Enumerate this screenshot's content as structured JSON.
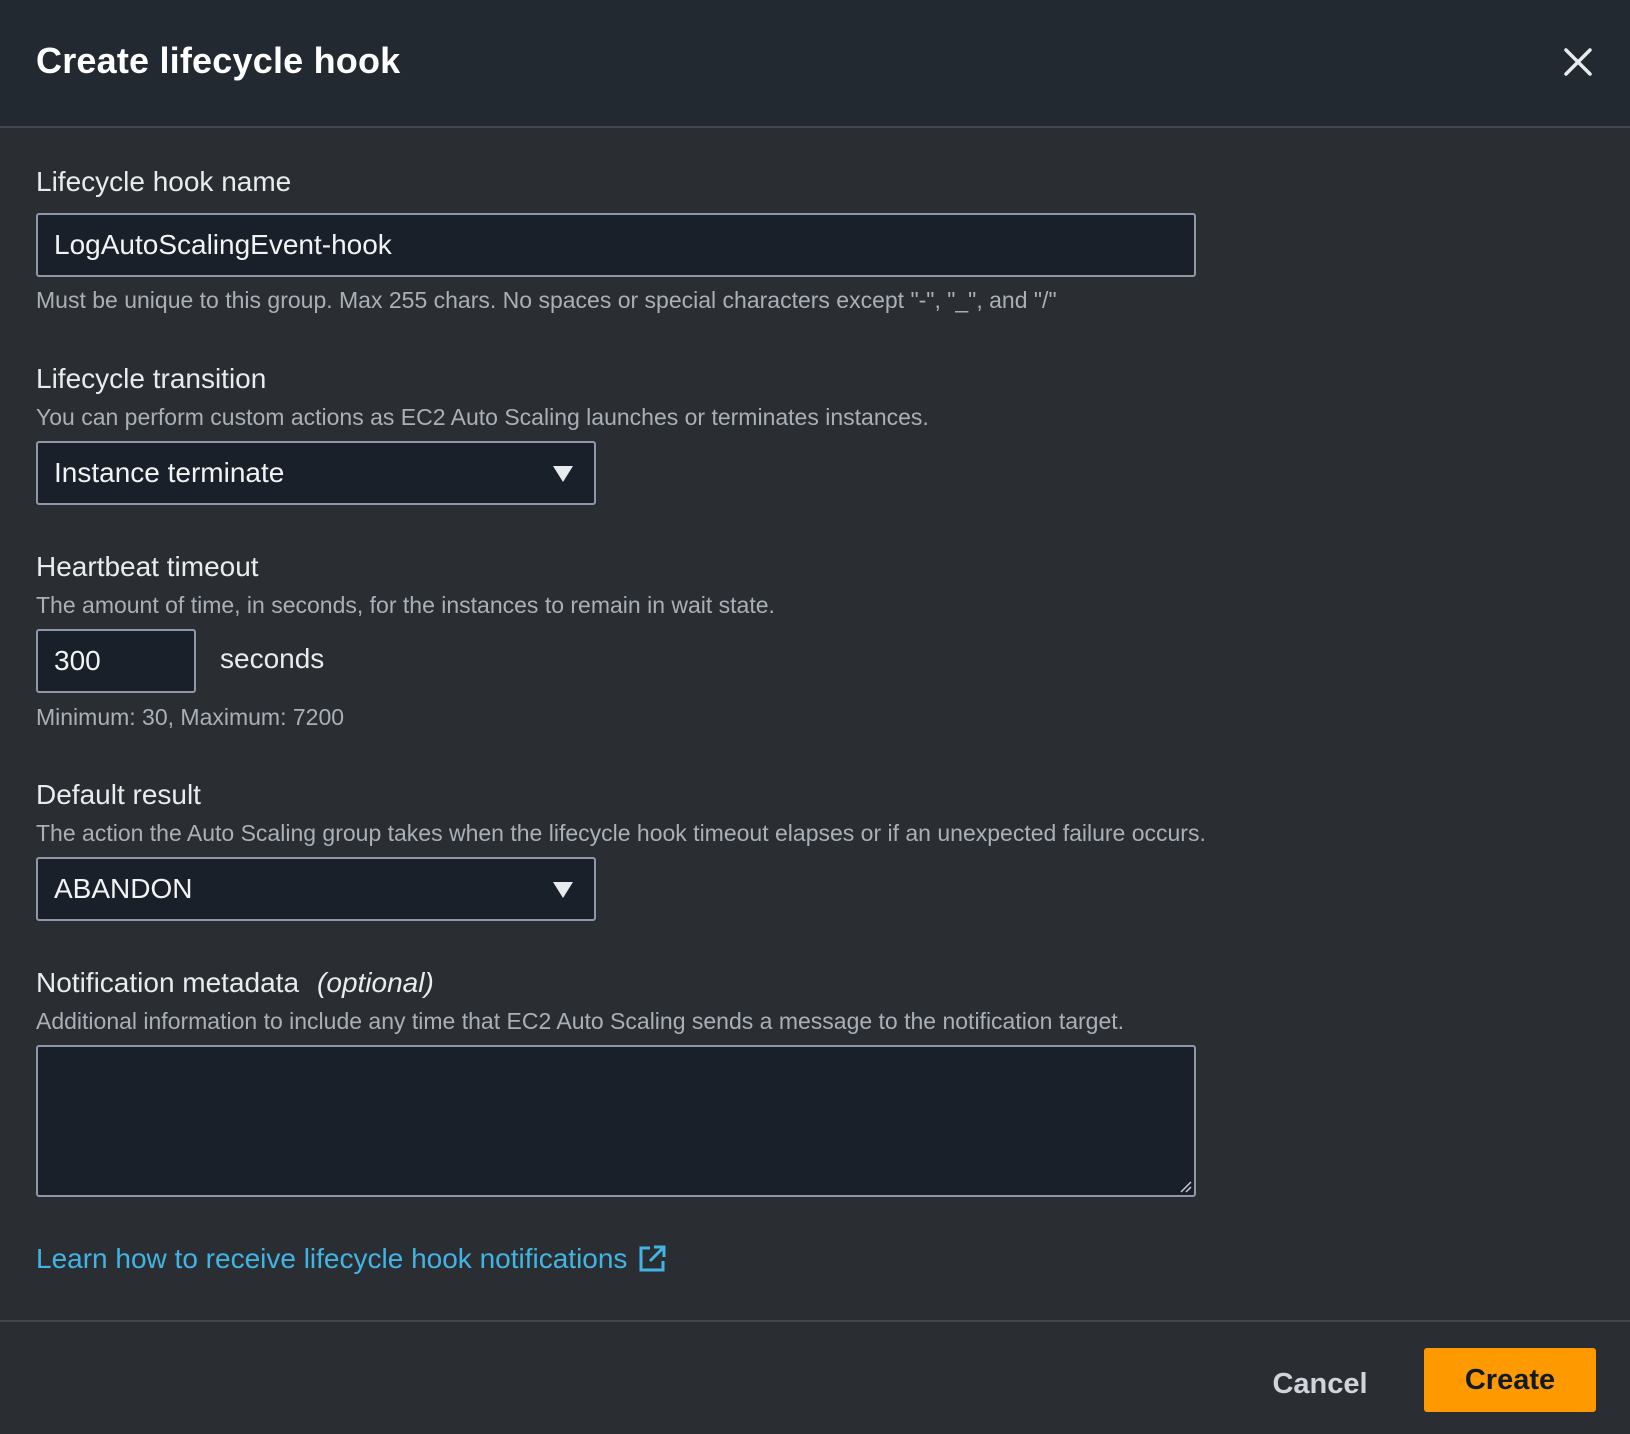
{
  "modal": {
    "title": "Create lifecycle hook",
    "close_icon": "close-icon"
  },
  "hook_name": {
    "label": "Lifecycle hook name",
    "value": "LogAutoScalingEvent-hook",
    "constraint": "Must be unique to this group. Max 255 chars. No spaces or special characters except \"-\", \"_\", and \"/\""
  },
  "transition": {
    "label": "Lifecycle transition",
    "description": "You can perform custom actions as EC2 Auto Scaling launches or terminates instances.",
    "selected": "Instance terminate",
    "caret_icon": "caret-down-icon"
  },
  "heartbeat": {
    "label": "Heartbeat timeout",
    "description": "The amount of time, in seconds, for the instances to remain in wait state.",
    "value": "300",
    "unit": "seconds",
    "constraint": "Minimum: 30, Maximum: 7200"
  },
  "default_result": {
    "label": "Default result",
    "description": "The action the Auto Scaling group takes when the lifecycle hook timeout elapses or if an unexpected failure occurs.",
    "selected": "ABANDON",
    "caret_icon": "caret-down-icon"
  },
  "metadata": {
    "label": "Notification metadata",
    "optional": "(optional)",
    "description": "Additional information to include any time that EC2 Auto Scaling sends a message to the notification target.",
    "value": ""
  },
  "learn_link": {
    "text": "Learn how to receive lifecycle hook notifications",
    "icon": "external-link-icon"
  },
  "footer": {
    "cancel_label": "Cancel",
    "create_label": "Create"
  },
  "colors": {
    "background": "#2a2e33",
    "header": "#232930",
    "input_bg": "#19202a",
    "input_border": "#8d99a8",
    "link": "#42b4e3",
    "primary_button": "#ff9900"
  }
}
